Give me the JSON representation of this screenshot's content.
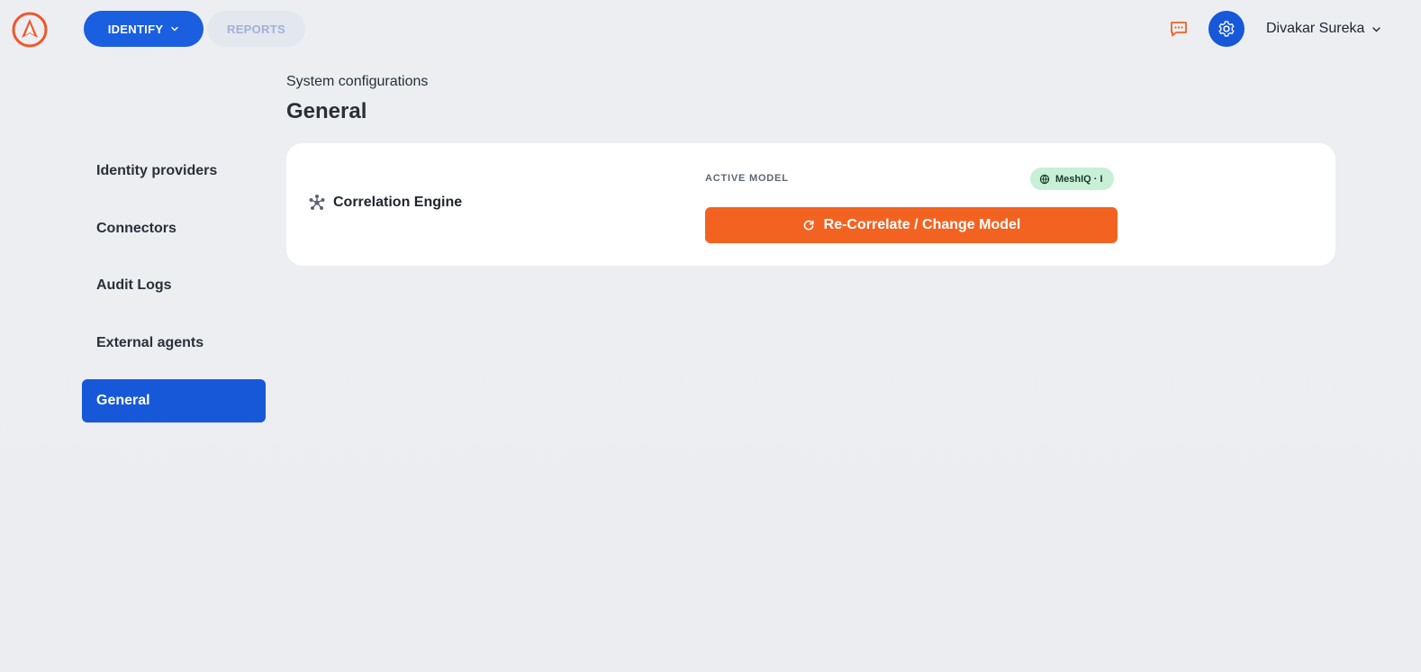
{
  "topbar": {
    "nav": [
      {
        "label": "IDENTIFY",
        "active": true
      },
      {
        "label": "REPORTS",
        "active": false
      }
    ],
    "user_name": "Divakar Sureka",
    "icons": {
      "logo": "compass-logo-icon",
      "messages": "message-icon",
      "settings": "gear-icon"
    }
  },
  "header": {
    "breadcrumb": "System configurations",
    "title": "General"
  },
  "sidebar": {
    "items": [
      {
        "label": "Identity providers",
        "active": false
      },
      {
        "label": "Connectors",
        "active": false
      },
      {
        "label": "Audit Logs",
        "active": false
      },
      {
        "label": "External agents",
        "active": false
      },
      {
        "label": "General",
        "active": true
      }
    ]
  },
  "card": {
    "section_label": "Correlation Engine",
    "active_model_label": "ACTIVE MODEL",
    "model_badge": "MeshIQ · I",
    "action_label": "Re-Correlate / Change Model"
  },
  "colors": {
    "accent_blue": "#1758d8",
    "accent_orange": "#f26322",
    "badge_green": "#c7f0d7"
  }
}
